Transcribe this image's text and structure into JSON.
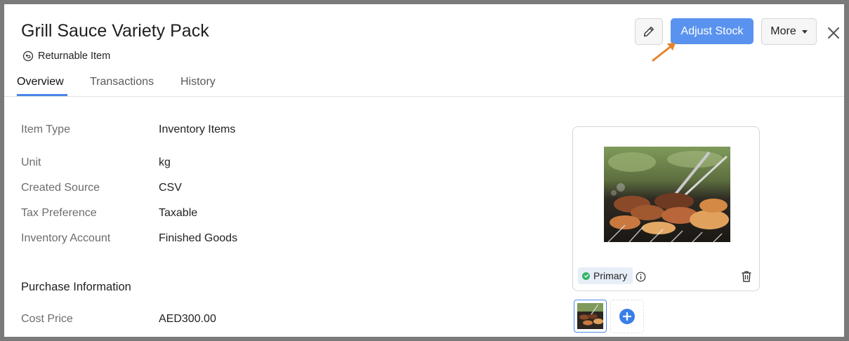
{
  "header": {
    "title": "Grill Sauce Variety Pack",
    "returnable_label": "Returnable Item",
    "adjust_stock_label": "Adjust Stock",
    "more_label": "More"
  },
  "tabs": [
    {
      "label": "Overview",
      "active": true
    },
    {
      "label": "Transactions",
      "active": false
    },
    {
      "label": "History",
      "active": false
    }
  ],
  "details": [
    {
      "label": "Item Type",
      "value": "Inventory Items"
    },
    {
      "label": "Unit",
      "value": "kg"
    },
    {
      "label": "Created Source",
      "value": "CSV"
    },
    {
      "label": "Tax Preference",
      "value": "Taxable"
    },
    {
      "label": "Inventory Account",
      "value": "Finished Goods"
    }
  ],
  "purchase": {
    "section_title": "Purchase Information",
    "rows": [
      {
        "label": "Cost Price",
        "value": "AED300.00"
      }
    ]
  },
  "image_panel": {
    "primary_badge": "Primary",
    "photo_icon": "grill-photo",
    "info_icon": "info-icon",
    "delete_icon": "trash-icon",
    "add_icon": "plus-icon"
  },
  "colors": {
    "accent": "#5a93ef",
    "tab_underline": "#4a86e8",
    "primary_check": "#35b46a",
    "annotation_arrow": "#e8822a"
  }
}
